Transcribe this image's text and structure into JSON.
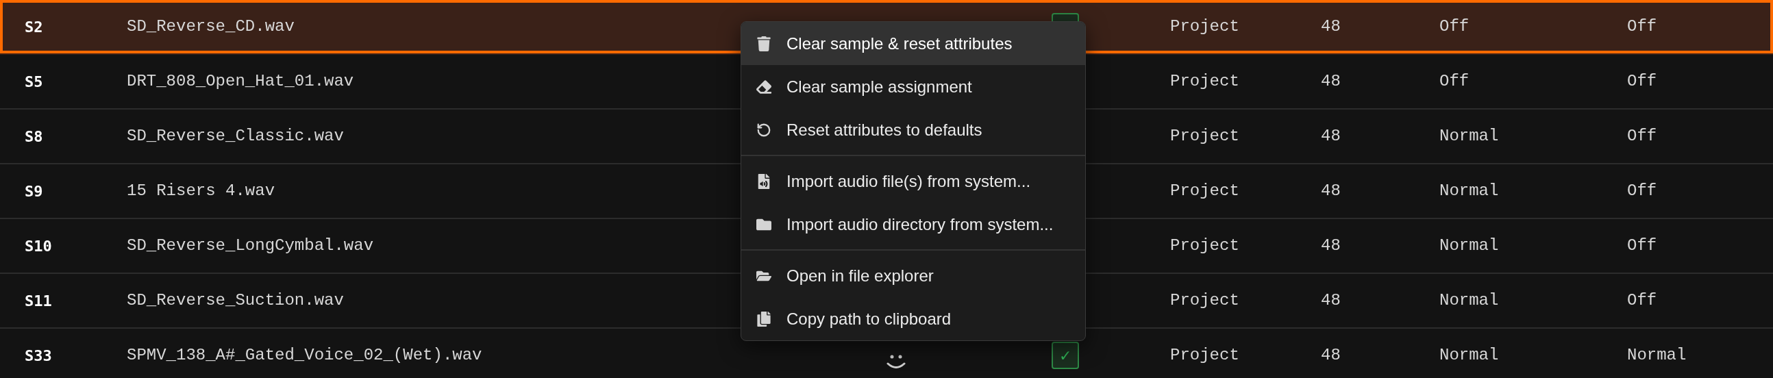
{
  "rows": [
    {
      "id": "S2",
      "name": "SD_Reverse_CD.wav",
      "selected": true,
      "checked": true,
      "source": "Project",
      "value": "48",
      "mode": "Off",
      "column_7": "Off"
    },
    {
      "id": "S5",
      "name": "DRT_808_Open_Hat_01.wav",
      "selected": false,
      "source": "Project",
      "value": "48",
      "mode": "Off",
      "column_7": "Off"
    },
    {
      "id": "S8",
      "name": "SD_Reverse_Classic.wav",
      "selected": false,
      "source": "Project",
      "value": "48",
      "mode": "Normal",
      "column_7": "Off"
    },
    {
      "id": "S9",
      "name": "15 Risers 4.wav",
      "selected": false,
      "source": "Project",
      "value": "48",
      "mode": "Normal",
      "column_7": "Off"
    },
    {
      "id": "S10",
      "name": "SD_Reverse_LongCymbal.wav",
      "selected": false,
      "source": "Project",
      "value": "48",
      "mode": "Normal",
      "column_7": "Off"
    },
    {
      "id": "S11",
      "name": "SD_Reverse_Suction.wav",
      "selected": false,
      "source": "Project",
      "value": "48",
      "mode": "Normal",
      "column_7": "Off"
    },
    {
      "id": "S33",
      "name": "SPMV_138_A#_Gated_Voice_02_(Wet).wav",
      "selected": false,
      "checked": true,
      "check": "✓",
      "kind": "with-status",
      "source": "Project",
      "value": "48",
      "mode": "Normal",
      "column_7": "Normal"
    }
  ],
  "context_menu": {
    "groups": [
      [
        {
          "label": "Clear sample & reset attributes",
          "highlighted": true
        },
        {
          "label": "Clear sample assignment",
          "highlighted": false
        },
        {
          "label": "Reset attributes to defaults",
          "highlighted": false
        }
      ],
      [
        {
          "label": "Import audio file(s) from system...",
          "highlighted": false
        },
        {
          "label": "Import audio directory from system...",
          "highlighted": false
        }
      ],
      [
        {
          "label": "Open in file explorer",
          "highlighted": false
        },
        {
          "label": "Copy path to clipboard",
          "highlighted": false
        }
      ]
    ]
  }
}
